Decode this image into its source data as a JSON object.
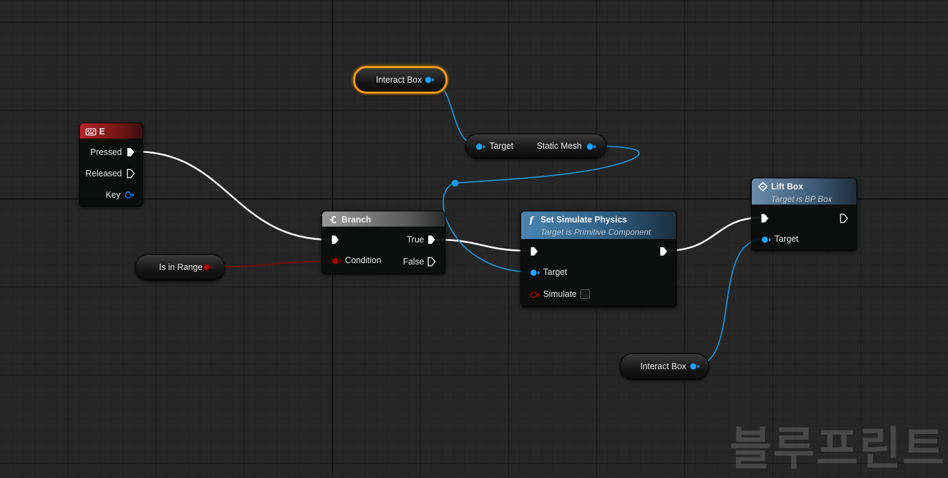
{
  "nodes": {
    "key_e": {
      "title": "E",
      "pins": {
        "pressed": "Pressed",
        "released": "Released",
        "key": "Key"
      }
    },
    "branch": {
      "title": "Branch",
      "pins": {
        "condition": "Condition",
        "true": "True",
        "false": "False"
      }
    },
    "set_sim": {
      "title": "Set Simulate Physics",
      "subtitle": "Target is Primitive Component",
      "pins": {
        "target": "Target",
        "simulate": "Simulate"
      },
      "simulate_checked": false
    },
    "lift_box": {
      "title": "Lift Box",
      "subtitle": "Target is BP Box",
      "pins": {
        "target": "Target"
      }
    },
    "static_mesh": {
      "pins": {
        "target": "Target",
        "output": "Static Mesh"
      }
    }
  },
  "variables": {
    "interact_box_top": "Interact Box",
    "interact_box_bottom": "Interact Box",
    "is_in_range": "Is in Range"
  },
  "watermark": "블루프린트",
  "colors": {
    "exec": "#ffffff",
    "object_pin": "#1aa3ff",
    "bool_pin": "#a50000",
    "selection": "#f39c12",
    "key_header": "#8c1a1a",
    "function_header": "#3c6f93",
    "branch_header": "#8d8d8d"
  },
  "icons": {
    "key_node": "keyboard-icon",
    "branch_node": "branch-icon",
    "function_node": "function-icon",
    "event_node": "custom-event-icon"
  }
}
